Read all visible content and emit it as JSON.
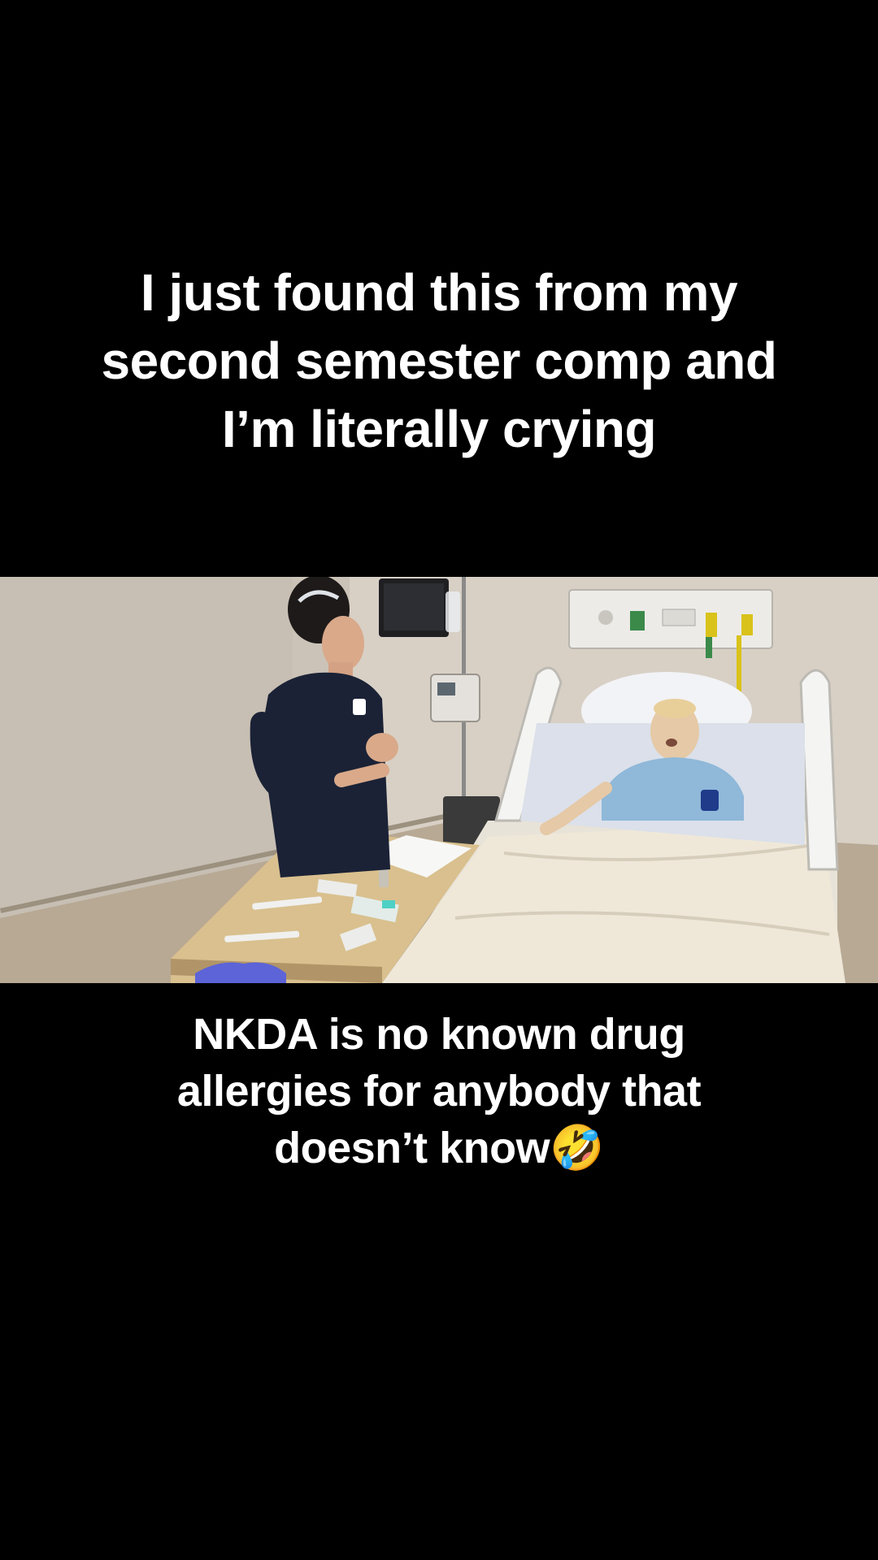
{
  "top_caption": {
    "lines": [
      "I just found this from my",
      "second semester comp and",
      "I’m literally crying"
    ]
  },
  "bottom_caption": {
    "lines": [
      "NKDA is no known drug",
      "allergies for anybody that",
      "doesn’t know🤣"
    ]
  },
  "colors": {
    "background": "#000000",
    "caption_text": "#ffffff"
  }
}
